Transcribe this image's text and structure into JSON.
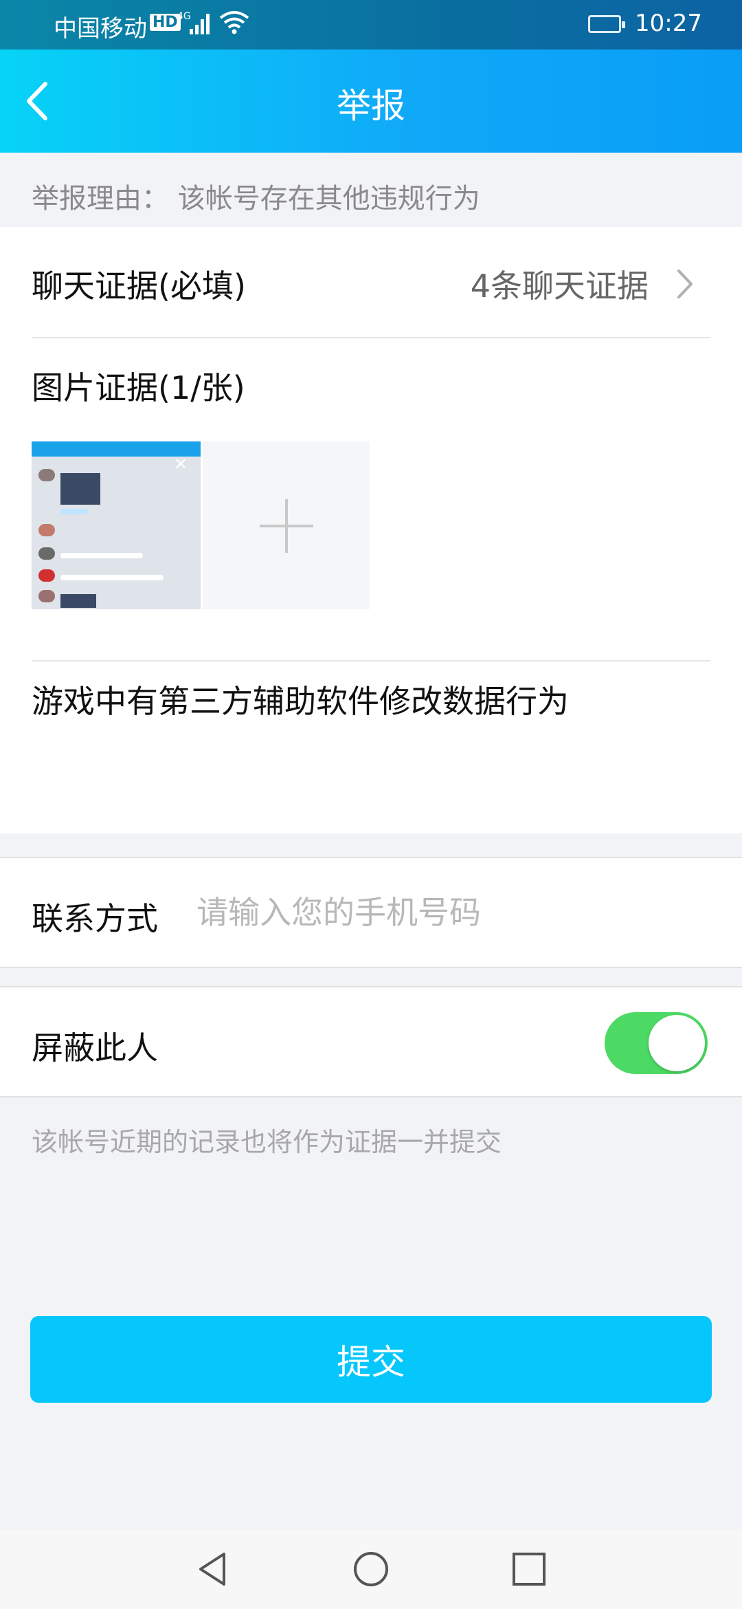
{
  "status_bar": {
    "carrier": "中国移动",
    "hd": "HD",
    "network": "4G",
    "time": "10:27"
  },
  "header": {
    "title": "举报",
    "back_icon": "chevron-left-icon"
  },
  "report": {
    "reason": "举报理由：  该帐号存在其他违规行为",
    "chat_evidence": {
      "label": "聊天证据(必填)",
      "value": "4条聊天证据"
    },
    "image_evidence": {
      "label": "图片证据(1/张)"
    },
    "description": "游戏中有第三方辅助软件修改数据行为"
  },
  "contact": {
    "label": "联系方式",
    "placeholder": "请输入您的手机号码"
  },
  "block": {
    "label": "屏蔽此人",
    "enabled": true
  },
  "note": "该帐号近期的记录也将作为证据一并提交",
  "submit_label": "提交",
  "colors": {
    "accent": "#05c7fb",
    "toggle_on": "#4cd964",
    "header_start": "#07d3f7",
    "header_end": "#0a9ef7"
  }
}
